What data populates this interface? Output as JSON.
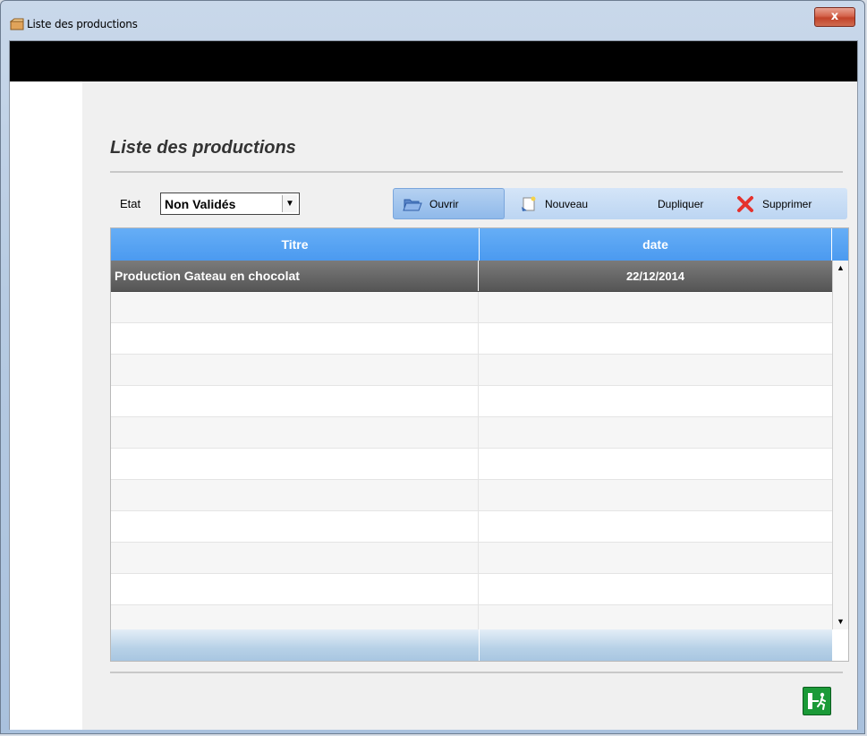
{
  "window": {
    "title": "Liste des productions",
    "close_label": "x"
  },
  "page": {
    "heading": "Liste des productions"
  },
  "filter": {
    "label": "Etat",
    "selected": "Non Validés"
  },
  "toolbar": {
    "open_label": "Ouvrir",
    "new_label": "Nouveau",
    "duplicate_label": "Dupliquer",
    "delete_label": "Supprimer"
  },
  "table": {
    "columns": [
      "Titre",
      "date"
    ],
    "rows": [
      {
        "titre": "Production Gateau en chocolat",
        "date": "22/12/2014",
        "selected": true
      }
    ]
  },
  "icons": {
    "app": "box-icon",
    "open": "folder-open-icon",
    "new": "new-document-icon",
    "delete": "red-x-icon",
    "exit": "exit-door-icon"
  },
  "colors": {
    "header_blue": "#4b9af0",
    "selected_row": "#5e5e5e",
    "exit_green": "#1b9a38",
    "delete_red": "#e5322d"
  }
}
